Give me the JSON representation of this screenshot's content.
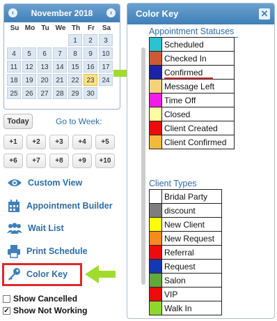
{
  "calendar": {
    "month_label": "November 2018",
    "prev_glyph": "‹",
    "next_glyph": "›",
    "weekdays": [
      "Su",
      "Mo",
      "Tu",
      "We",
      "Th",
      "Fr",
      "Sa"
    ],
    "leading_blanks": 4,
    "days": [
      "1",
      "2",
      "3",
      "4",
      "5",
      "6",
      "7",
      "8",
      "9",
      "10",
      "11",
      "12",
      "13",
      "14",
      "15",
      "16",
      "17",
      "18",
      "19",
      "20",
      "21",
      "22",
      "23",
      "24",
      "25",
      "26",
      "27",
      "28",
      "29",
      "30"
    ],
    "today": "23"
  },
  "today_button": "Today",
  "go_to_week_label": "Go to Week:",
  "week_buttons": [
    "+1",
    "+2",
    "+3",
    "+4",
    "+5",
    "+6",
    "+7",
    "+8",
    "+9",
    "+10"
  ],
  "menu": {
    "custom_view": "Custom View",
    "appointment_builder": "Appointment Builder",
    "wait_list": "Wait List",
    "print_schedule": "Print Schedule",
    "color_key": "Color Key"
  },
  "checkboxes": {
    "show_cancelled": {
      "label": "Show Cancelled",
      "checked": false
    },
    "show_not_working": {
      "label": "Show Not Working",
      "checked": true
    }
  },
  "color_key_panel": {
    "title": "Color Key",
    "close_glyph": "✕",
    "appointment_statuses_title": "Appointment Statuses",
    "appointment_statuses": [
      {
        "label": "Scheduled",
        "color": "#29c3d3"
      },
      {
        "label": "Checked In",
        "color": "#cc5a32"
      },
      {
        "label": "Confirmed",
        "color": "#1a24a8"
      },
      {
        "label": "Message Left",
        "color": "#f5d27a"
      },
      {
        "label": "Time Off",
        "color": "#f21ce8"
      },
      {
        "label": "Closed",
        "color": "#fdfca0"
      },
      {
        "label": "Client Created",
        "color": "#ee0b0b"
      },
      {
        "label": "Client Confirmed",
        "color": "#f4b83a"
      }
    ],
    "client_types_title": "Client Types",
    "client_types": [
      {
        "label": "Bridal Party",
        "color": "#ffffff"
      },
      {
        "label": "discount",
        "color": "#7e7e7e"
      },
      {
        "label": "New Client",
        "color": "#ffff00"
      },
      {
        "label": "New Request",
        "color": "#f58a1f"
      },
      {
        "label": "Referral",
        "color": "#ee0b0b"
      },
      {
        "label": "Request",
        "color": "#1537b4"
      },
      {
        "label": "Salon",
        "color": "#5fa83a"
      },
      {
        "label": "VIP",
        "color": "#ee0b0b"
      },
      {
        "label": "Walk In",
        "color": "#8ed82b"
      }
    ]
  },
  "colors": {
    "accent": "#2c6ea8",
    "highlight_box": "#e0262c",
    "arrow": "#9fdc2e",
    "today_cell": "#fde48a"
  }
}
